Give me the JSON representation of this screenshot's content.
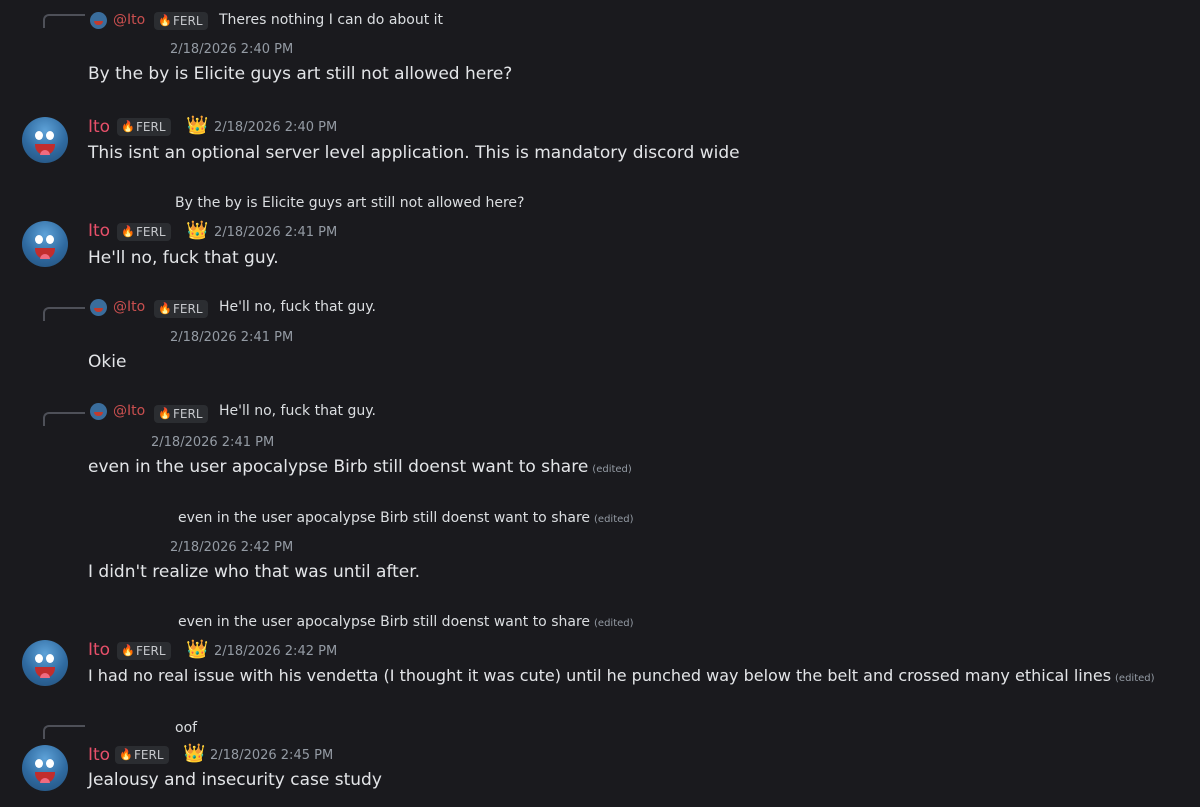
{
  "user": {
    "name": "Ito",
    "mention": "@Ito",
    "tag": "FERL"
  },
  "colors": {
    "background": "#1a1a1e",
    "username": "#e7506a",
    "mention": "#c94f4f",
    "timestamp": "#949ba4"
  },
  "icons": {
    "tag": "flame-icon",
    "badge": "crown-icon"
  },
  "m1": {
    "reply": "Theres nothing I can do about it",
    "time": "2/18/2026 2:40 PM",
    "text": "By the by is Elicite guys art still not allowed here?"
  },
  "m2": {
    "time": "2/18/2026 2:40 PM",
    "text": "This isnt an optional server level application. This is mandatory discord wide"
  },
  "m3": {
    "reply": "By the by is Elicite guys art still not allowed here?",
    "time": "2/18/2026 2:41 PM",
    "text": "He'll no, fuck that guy."
  },
  "m4": {
    "reply": "He'll no, fuck that guy.",
    "time": "2/18/2026 2:41 PM",
    "text": "Okie"
  },
  "m5": {
    "reply": "He'll no, fuck that guy.",
    "time": "2/18/2026 2:41 PM",
    "text": "even in the user apocalypse Birb still doenst want to share",
    "edited": "(edited)"
  },
  "m6": {
    "reply": "even in the user apocalypse Birb still doenst want to share",
    "reply_edited": "(edited)",
    "time": "2/18/2026 2:42 PM",
    "text": "I didn't realize who that was until after."
  },
  "m7": {
    "reply": "even in the user apocalypse Birb still doenst want to share",
    "reply_edited": "(edited)",
    "time": "2/18/2026 2:42 PM",
    "text": "I had no real issue with his vendetta (I thought it was cute) until he punched way below the belt and crossed many ethical lines",
    "edited": "(edited)"
  },
  "m8": {
    "reply": "oof",
    "time": "2/18/2026 2:45 PM",
    "text": "Jealousy and insecurity case study"
  }
}
